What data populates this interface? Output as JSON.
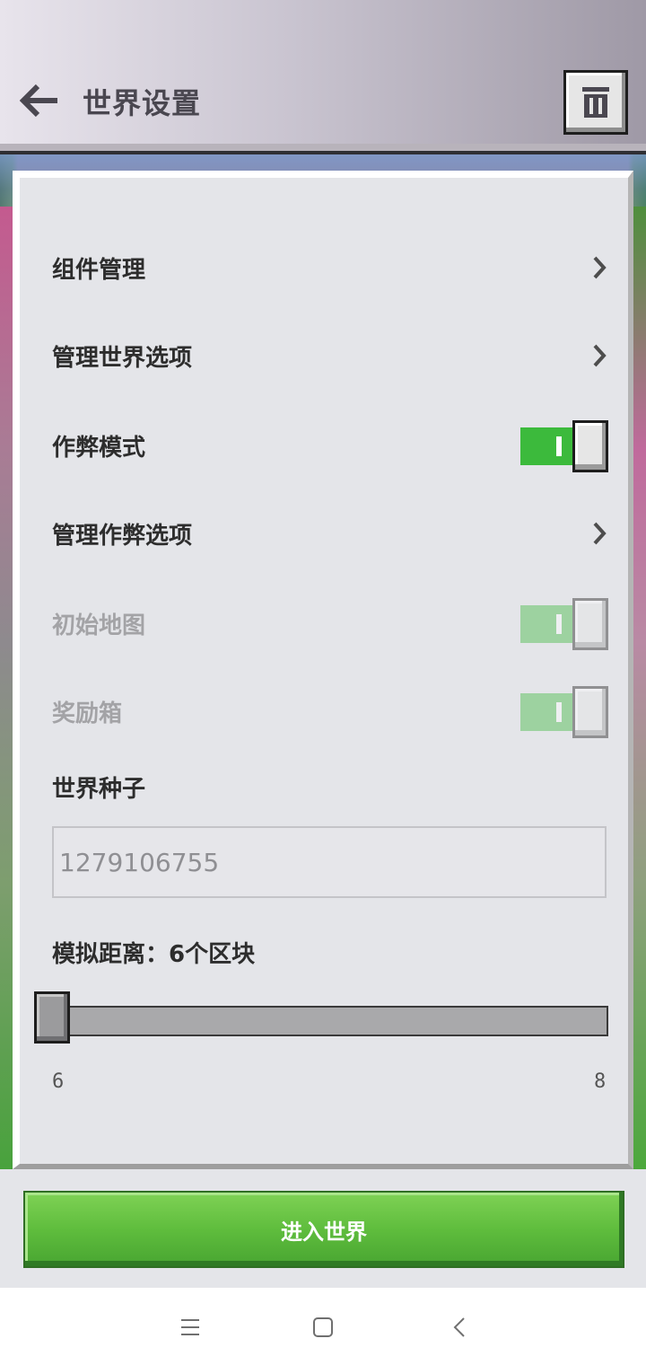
{
  "header": {
    "title": "世界设置"
  },
  "settings": {
    "addons": {
      "label": "组件管理"
    },
    "world_options": {
      "label": "管理世界选项"
    },
    "cheats_mode": {
      "label": "作弊模式",
      "enabled": true
    },
    "cheat_options": {
      "label": "管理作弊选项"
    },
    "starting_map": {
      "label": "初始地图",
      "enabled": true,
      "disabled": true
    },
    "bonus_chest": {
      "label": "奖励箱",
      "enabled": true,
      "disabled": true
    },
    "seed": {
      "label": "世界种子",
      "value": "1279106755"
    },
    "simulation_distance": {
      "label": "模拟距离：6个区块",
      "min": "6",
      "max": "8",
      "value": 6
    }
  },
  "footer": {
    "enter_button": "进入世界"
  },
  "colors": {
    "accent_green": "#3cba3c",
    "button_green": "#5fbd3d",
    "panel_bg": "#e4e5e9"
  },
  "icons": [
    "back-arrow-icon",
    "trash-icon",
    "chevron-right-icon",
    "menu-icon",
    "home-icon",
    "back-icon"
  ]
}
